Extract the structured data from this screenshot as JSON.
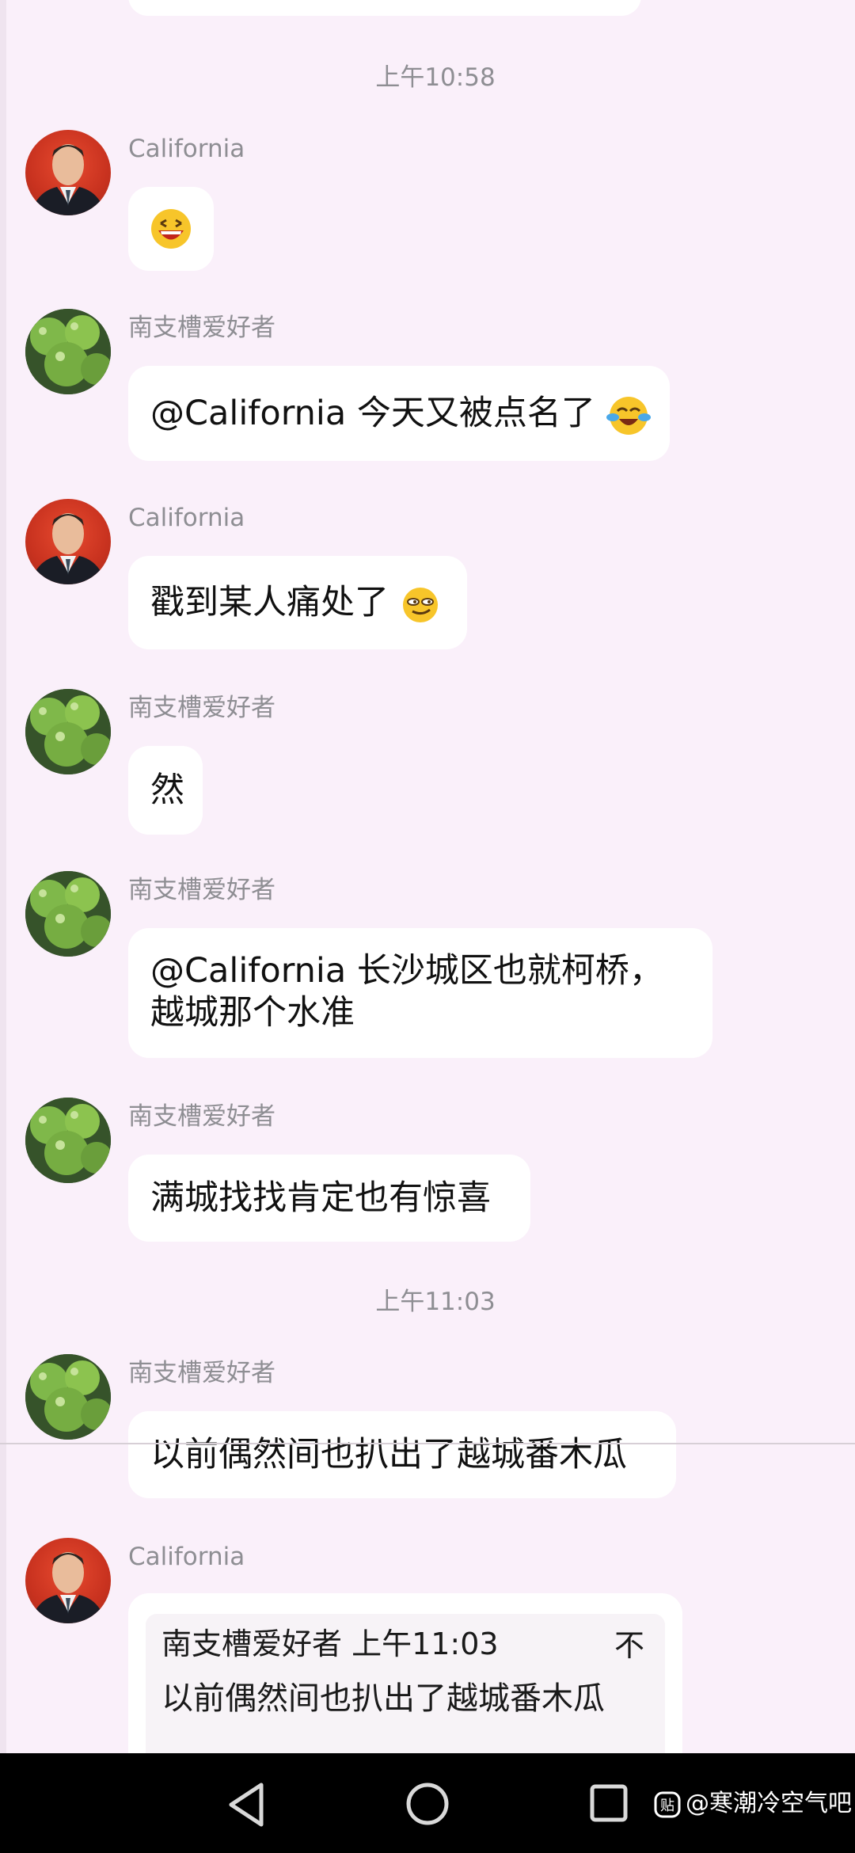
{
  "timestamps": [
    "上午10:58",
    "上午11:03"
  ],
  "messages": [
    {
      "sender": "California",
      "text": ""
    },
    {
      "sender": "南支槽爱好者",
      "text": "@California 今天又被点名了"
    },
    {
      "sender": "California",
      "text": "戳到某人痛处了"
    },
    {
      "sender": "南支槽爱好者",
      "text": "然"
    },
    {
      "sender": "南支槽爱好者",
      "line1": "@California 长沙城区也就柯桥，",
      "line2": "越城那个水准"
    },
    {
      "sender": "南支槽爱好者",
      "text": "满城找找肯定也有惊喜"
    },
    {
      "sender": "南支槽爱好者",
      "text": "以前偶然间也扒出了越城番木瓜"
    },
    {
      "sender": "California",
      "quote_header": "南支槽爱好者 上午11:03",
      "quote_text": "以前偶然间也扒出了越城番木瓜",
      "quote_action": "不"
    }
  ],
  "watermark": "@寒潮冷空气吧",
  "icons": {
    "emoji_grin": "grinning-face",
    "emoji_tears": "tears-of-joy-face",
    "emoji_smirk": "smirk-face",
    "back": "back-triangle",
    "home": "home-circle",
    "recents": "recents-square"
  }
}
